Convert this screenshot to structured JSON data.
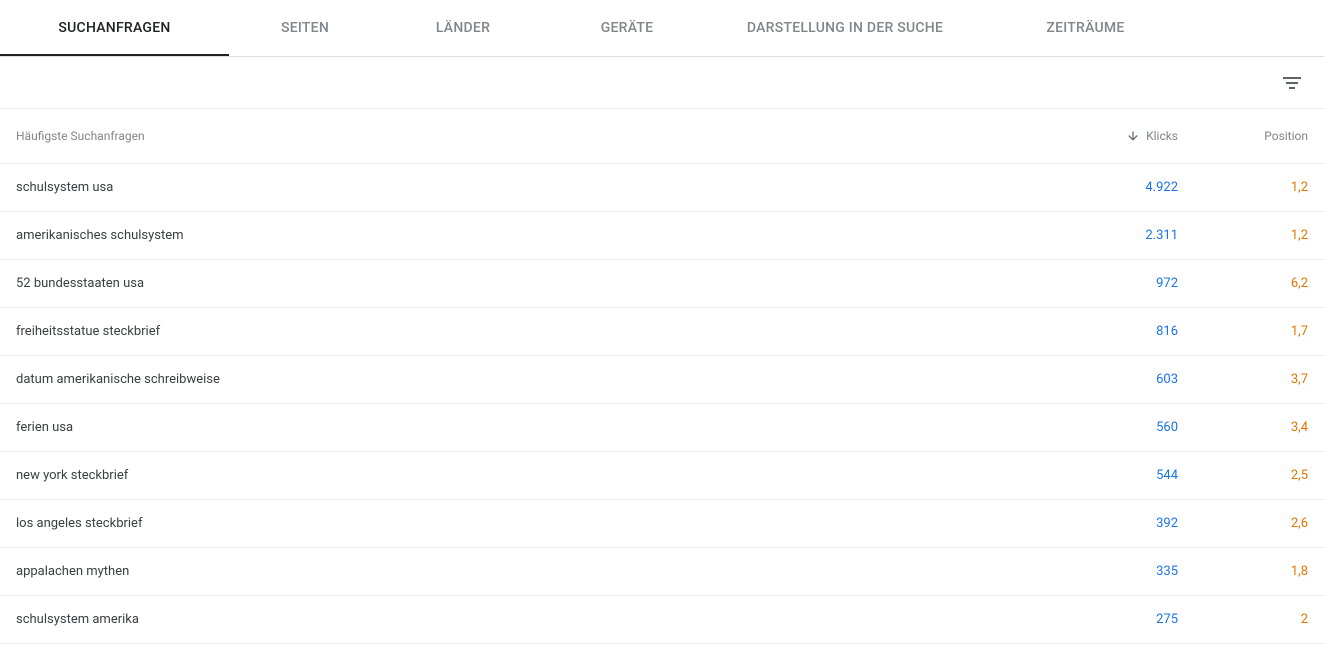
{
  "tabs": {
    "items": [
      {
        "label": "Suchanfragen",
        "active": true
      },
      {
        "label": "Seiten",
        "active": false
      },
      {
        "label": "Länder",
        "active": false
      },
      {
        "label": "Geräte",
        "active": false
      },
      {
        "label": "Darstellung in der Suche",
        "active": false
      },
      {
        "label": "Zeiträume",
        "active": false
      }
    ]
  },
  "table": {
    "headers": {
      "query": "Häufigste Suchanfragen",
      "clicks": "Klicks",
      "position": "Position"
    },
    "sort": {
      "column": "clicks",
      "direction": "desc"
    },
    "rows": [
      {
        "query": "schulsystem usa",
        "clicks": "4.922",
        "position": "1,2"
      },
      {
        "query": "amerikanisches schulsystem",
        "clicks": "2.311",
        "position": "1,2"
      },
      {
        "query": "52 bundesstaaten usa",
        "clicks": "972",
        "position": "6,2"
      },
      {
        "query": "freiheitsstatue steckbrief",
        "clicks": "816",
        "position": "1,7"
      },
      {
        "query": "datum amerikanische schreibweise",
        "clicks": "603",
        "position": "3,7"
      },
      {
        "query": "ferien usa",
        "clicks": "560",
        "position": "3,4"
      },
      {
        "query": "new york steckbrief",
        "clicks": "544",
        "position": "2,5"
      },
      {
        "query": "los angeles steckbrief",
        "clicks": "392",
        "position": "2,6"
      },
      {
        "query": "appalachen mythen",
        "clicks": "335",
        "position": "1,8"
      },
      {
        "query": "schulsystem amerika",
        "clicks": "275",
        "position": "2"
      }
    ]
  }
}
